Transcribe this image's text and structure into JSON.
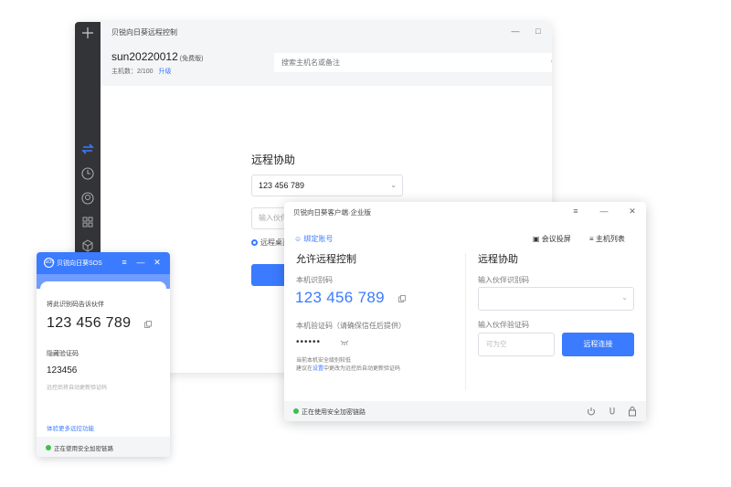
{
  "main_window": {
    "title": "贝锐向日葵远程控制",
    "controls": {
      "minimize": "—",
      "maximize": "□",
      "close": "✕"
    },
    "user": {
      "name": "sun20220012",
      "tag": "(免费版)"
    },
    "host_count": {
      "label": "主机数：",
      "value": "2/100",
      "upgrade": "升级"
    },
    "search": {
      "placeholder": "搜索主机名或备注"
    },
    "assist": {
      "title": "远程协助",
      "id_value": "123 456 789",
      "pw_placeholder": "输入伙伴",
      "radio_label": "远程桌面"
    },
    "sidebar_icons": [
      "plus-icon",
      "transfer-icon",
      "history-icon",
      "remote-icon",
      "apps-icon",
      "cube-icon"
    ]
  },
  "sos_window": {
    "title": "贝锐向日葵SOS",
    "logo_text": "SOS",
    "controls": {
      "menu": "≡",
      "minimize": "—",
      "close": "✕"
    },
    "share_label": "将此识别码告诉伙伴",
    "id_value": "123 456 789",
    "code_label": "隐藏验证码",
    "code_value": "123456",
    "code_hint": "远控后将自动更新验证码",
    "more_link": "体验更多远控功能",
    "status": "正在使用安全加密链路"
  },
  "client_window": {
    "title": "贝锐向日葵客户端·企业版",
    "controls": {
      "menu": "≡",
      "minimize": "—",
      "close": "✕"
    },
    "bind_account": "绑定账号",
    "meeting_cast": "会议投屏",
    "host_list": "主机列表",
    "allow": {
      "title": "允许远程控制",
      "local_id_label": "本机识别码",
      "local_id_value": "123 456 789",
      "local_code_label": "本机验证码（请确保信任后提供）",
      "local_code_value": "••••••",
      "note_1": "当前本机安全级别较低",
      "note_2_prefix": "建议在",
      "note_2_link": "设置",
      "note_2_suffix": "中更改为远控后自动更新验证码"
    },
    "assist": {
      "title": "远程协助",
      "partner_id_label": "输入伙伴识别码",
      "partner_code_label": "输入伙伴验证码",
      "partner_code_placeholder": "可为空",
      "connect": "远程连接"
    },
    "status": "正在使用安全加密链路"
  },
  "colors": {
    "accent": "#3a7bff",
    "sidebar": "#333438",
    "status_green": "#3cc04a"
  }
}
